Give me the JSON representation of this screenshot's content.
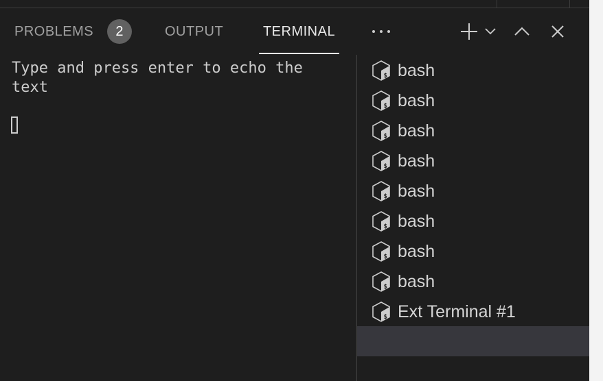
{
  "tabs": {
    "problems_label": "PROBLEMS",
    "problems_count": "2",
    "output_label": "OUTPUT",
    "terminal_label": "TERMINAL",
    "more_label": "···"
  },
  "toolbar_icons": [
    "plus-icon",
    "chevron-down-icon",
    "chevron-up-icon",
    "close-icon"
  ],
  "terminal": {
    "output_text": "Type and press enter to echo the text"
  },
  "terminal_list": {
    "items": [
      {
        "label": "bash",
        "icon": "terminal-bash-icon"
      },
      {
        "label": "bash",
        "icon": "terminal-bash-icon"
      },
      {
        "label": "bash",
        "icon": "terminal-bash-icon"
      },
      {
        "label": "bash",
        "icon": "terminal-bash-icon"
      },
      {
        "label": "bash",
        "icon": "terminal-bash-icon"
      },
      {
        "label": "bash",
        "icon": "terminal-bash-icon"
      },
      {
        "label": "bash",
        "icon": "terminal-bash-icon"
      },
      {
        "label": "bash",
        "icon": "terminal-bash-icon"
      },
      {
        "label": "Ext Terminal #1",
        "icon": "terminal-bash-icon"
      }
    ]
  },
  "colors": {
    "panel_background": "#1e1e1e",
    "active_tab_text": "#e7e7e7",
    "inactive_tab_text": "#a0a0a0",
    "badge_background": "#616161",
    "selected_row_background": "#37373d"
  }
}
